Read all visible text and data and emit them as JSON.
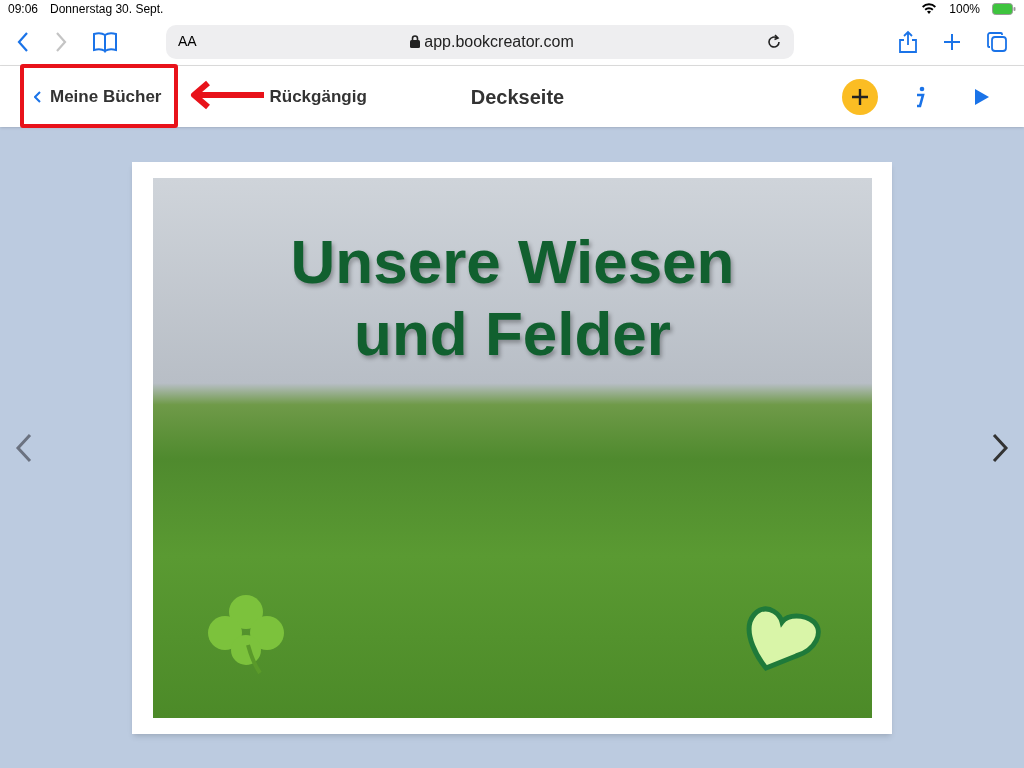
{
  "status_bar": {
    "time": "09:06",
    "date": "Donnerstag 30. Sept.",
    "battery": "100%"
  },
  "browser": {
    "text_size_button": "AA",
    "url": "app.bookcreator.com"
  },
  "app_bar": {
    "back": "Meine Bücher",
    "undo": "Rückgängig",
    "title": "Deckseite"
  },
  "page": {
    "title_lines": [
      "Unsere Wiesen",
      "und Felder"
    ]
  },
  "annotation": {
    "highlight": true
  }
}
